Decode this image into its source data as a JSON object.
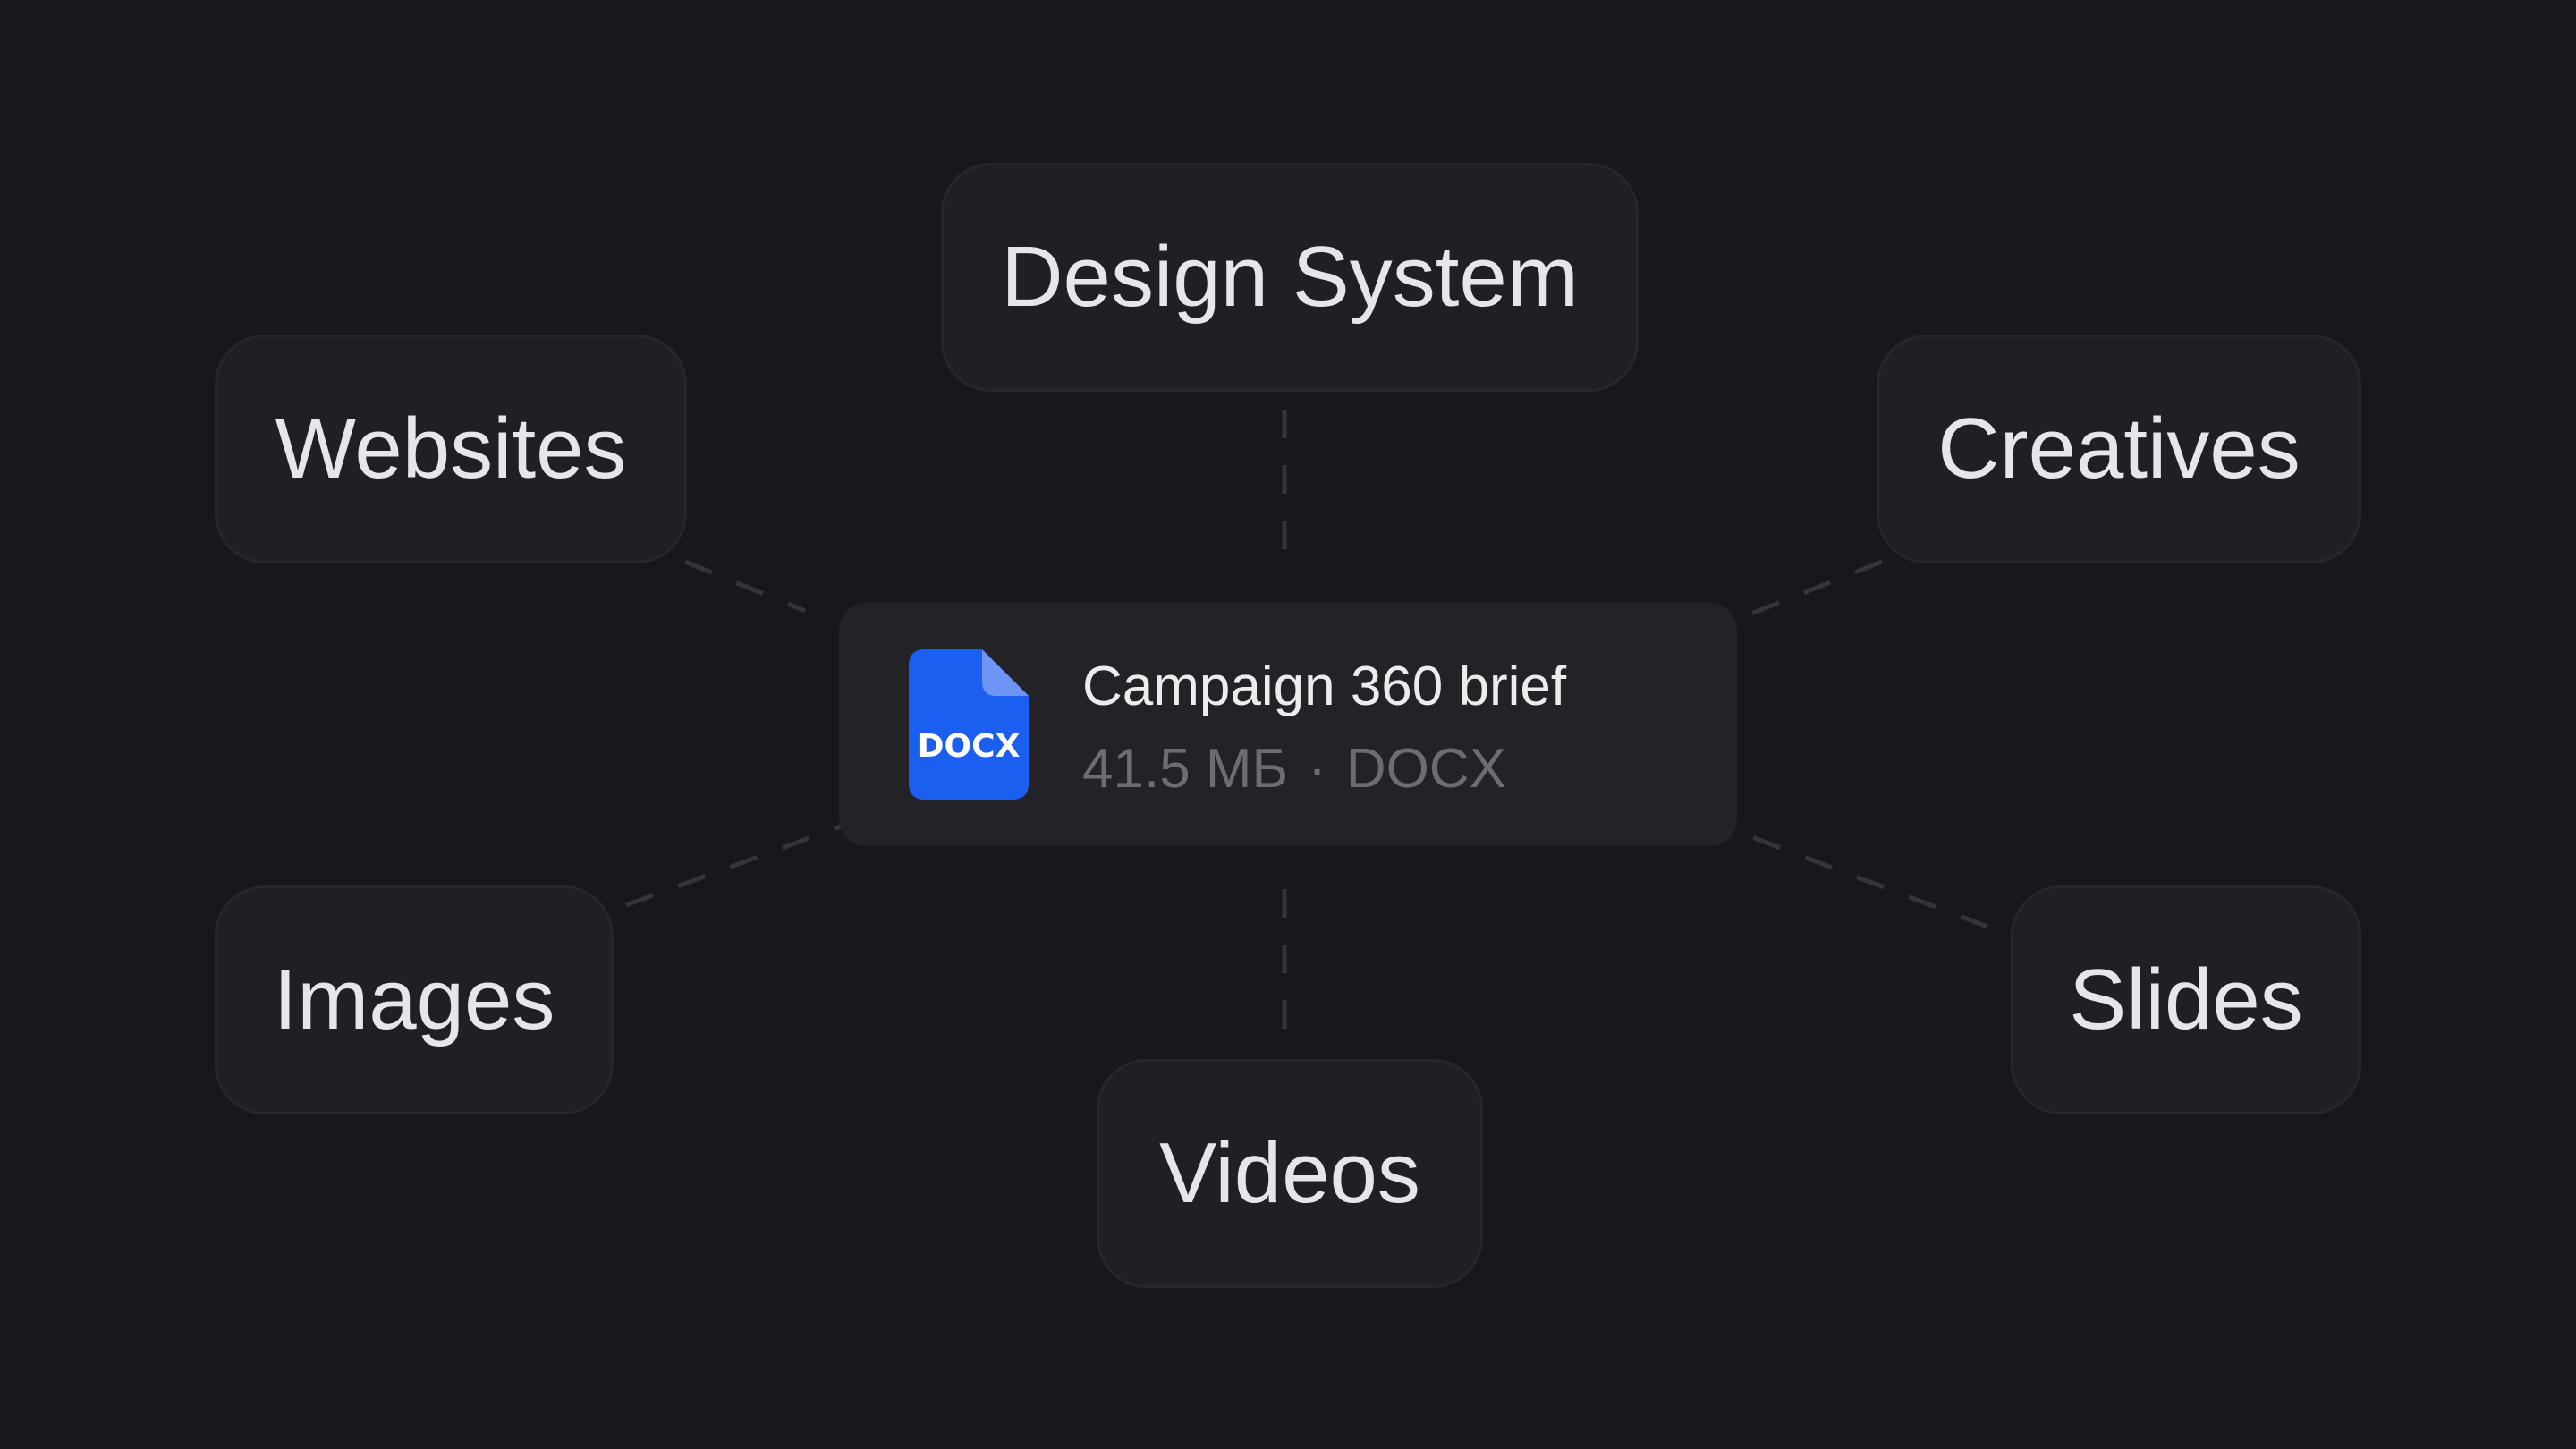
{
  "nodes": {
    "design_system": "Design System",
    "websites": "Websites",
    "creatives": "Creatives",
    "images": "Images",
    "slides": "Slides",
    "videos": "Videos"
  },
  "file": {
    "name": "Campaign 360 brief",
    "size": "41.5 МБ",
    "separator": "·",
    "type": "DOCX",
    "icon_label": "DOCX",
    "icon": "document-icon"
  },
  "colors": {
    "background": "#18181c",
    "node_fill": "#1f1f24",
    "card_fill": "#222227",
    "icon_blue": "#1a5ff0",
    "icon_fold": "#6e95f5",
    "connector": "#34343a"
  }
}
